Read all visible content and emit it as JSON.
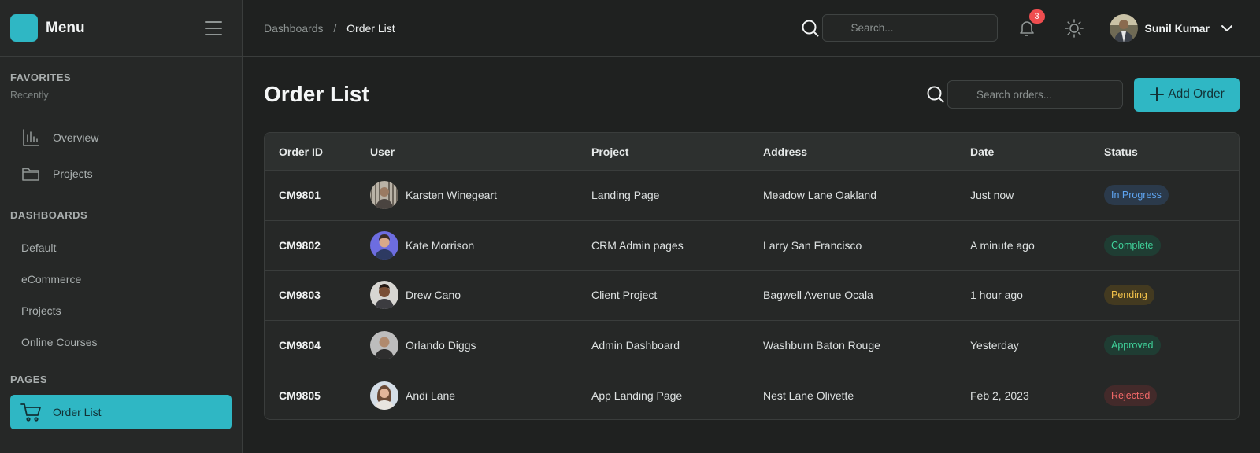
{
  "sidebar": {
    "title": "Menu",
    "favorites": {
      "title": "FAVORITES",
      "sub": "Recently"
    },
    "fav_items": [
      {
        "label": "Overview",
        "icon": "bar-chart-icon"
      },
      {
        "label": "Projects",
        "icon": "folder-icon"
      }
    ],
    "dashboards": {
      "title": "DASHBOARDS",
      "items": [
        "Default",
        "eCommerce",
        "Projects",
        "Online Courses"
      ]
    },
    "pages": {
      "title": "PAGES",
      "active": {
        "label": "Order List",
        "icon": "cart-icon"
      }
    }
  },
  "header": {
    "breadcrumb": {
      "parent": "Dashboards",
      "separator": "/",
      "current": "Order List"
    },
    "search_placeholder": "Search...",
    "notification_count": "3",
    "user_name": "Sunil Kumar"
  },
  "page": {
    "title": "Order List",
    "search_placeholder": "Search orders...",
    "add_button": "Add Order"
  },
  "table": {
    "columns": [
      "Order ID",
      "User",
      "Project",
      "Address",
      "Date",
      "Status"
    ],
    "rows": [
      {
        "id": "CM9801",
        "user": "Karsten Winegeart",
        "project": "Landing Page",
        "address": "Meadow Lane Oakland",
        "date": "Just now",
        "status": "In Progress"
      },
      {
        "id": "CM9802",
        "user": "Kate Morrison",
        "project": "CRM Admin pages",
        "address": "Larry San Francisco",
        "date": "A minute ago",
        "status": "Complete"
      },
      {
        "id": "CM9803",
        "user": "Drew Cano",
        "project": "Client Project",
        "address": "Bagwell Avenue Ocala",
        "date": "1 hour ago",
        "status": "Pending"
      },
      {
        "id": "CM9804",
        "user": "Orlando Diggs",
        "project": "Admin Dashboard",
        "address": "Washburn Baton Rouge",
        "date": "Yesterday",
        "status": "Approved"
      },
      {
        "id": "CM9805",
        "user": "Andi Lane",
        "project": "App Landing Page",
        "address": "Nest Lane Olivette",
        "date": "Feb 2, 2023",
        "status": "Rejected"
      }
    ]
  },
  "colors": {
    "accent": "#2fb7c4",
    "background": "#1f2120",
    "sidebar": "#262827",
    "in_progress": "#5ea4f0",
    "complete": "#3fd29a",
    "pending": "#f2c24a",
    "rejected": "#f06868",
    "badge": "#ef4d4f"
  }
}
